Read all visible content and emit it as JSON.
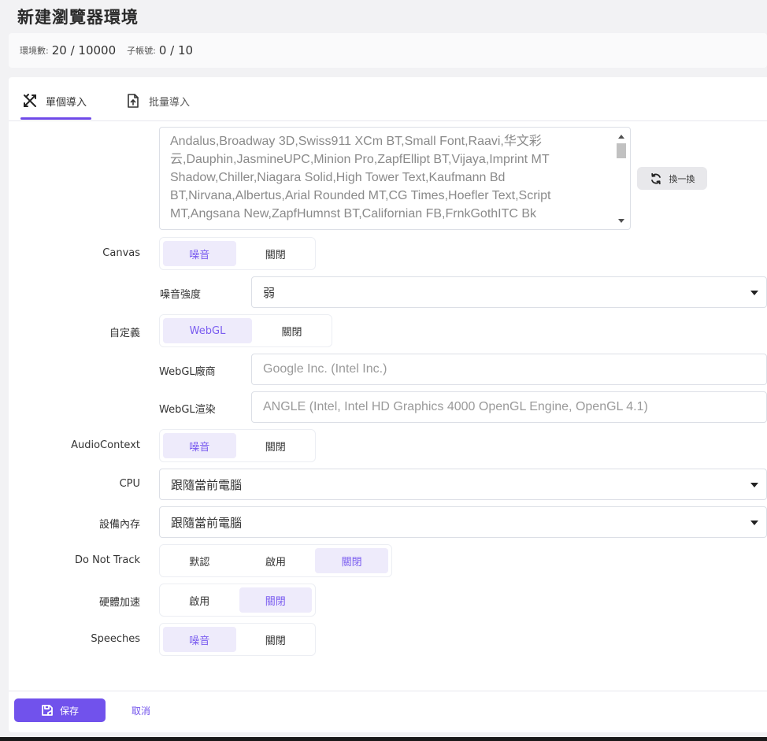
{
  "page": {
    "title": "新建瀏覽器環境"
  },
  "stats": {
    "env_label": "環境數:",
    "env_value": "20 / 10000",
    "sub_label": "子帳號:",
    "sub_value": "0 / 10"
  },
  "tabs": [
    {
      "label": "單個導入",
      "icon": "tools-icon",
      "active": true
    },
    {
      "label": "批量導入",
      "icon": "upload-file-icon",
      "active": false
    }
  ],
  "fonts": {
    "text": "Andalus,Broadway 3D,Swiss911 XCm BT,Small Font,Raavi,华文彩云,Dauphin,JasmineUPC,Minion Pro,ZapfEllipt BT,Vijaya,Imprint MT Shadow,Chiller,Niagara Solid,High Tower Text,Kaufmann Bd BT,Nirvana,Albertus,Arial Rounded MT,CG Times,Hoefler Text,Script MT,Angsana New,ZapfHumnst BT,Californian FB,FrnkGothITC Bk",
    "refresh_label": "換一換"
  },
  "canvas": {
    "label": "Canvas",
    "options": [
      "噪音",
      "關閉"
    ],
    "selected": "噪音",
    "strength_label": "噪音強度",
    "strength_value": "弱"
  },
  "webgl": {
    "label": "自定義",
    "options": [
      "WebGL",
      "關閉"
    ],
    "selected": "WebGL",
    "vendor_label": "WebGL廠商",
    "vendor_placeholder": "Google Inc. (Intel Inc.)",
    "renderer_label": "WebGL渲染",
    "renderer_placeholder": "ANGLE (Intel, Intel HD Graphics 4000 OpenGL Engine, OpenGL 4.1)"
  },
  "audio": {
    "label": "AudioContext",
    "options": [
      "噪音",
      "關閉"
    ],
    "selected": "噪音"
  },
  "cpu": {
    "label": "CPU",
    "value": "跟隨當前電腦"
  },
  "memory": {
    "label": "設備內存",
    "value": "跟隨當前電腦"
  },
  "dnt": {
    "label": "Do Not Track",
    "options": [
      "默認",
      "啟用",
      "關閉"
    ],
    "selected": "關閉"
  },
  "hw_accel": {
    "label": "硬體加速",
    "options": [
      "啟用",
      "關閉"
    ],
    "selected": "關閉"
  },
  "speeches": {
    "label": "Speeches",
    "options": [
      "噪音",
      "關閉"
    ],
    "selected": "噪音"
  },
  "footer": {
    "save_label": "保存",
    "cancel_label": "取消"
  },
  "colors": {
    "accent": "#7152ec",
    "active_bg": "#eeebfb"
  }
}
